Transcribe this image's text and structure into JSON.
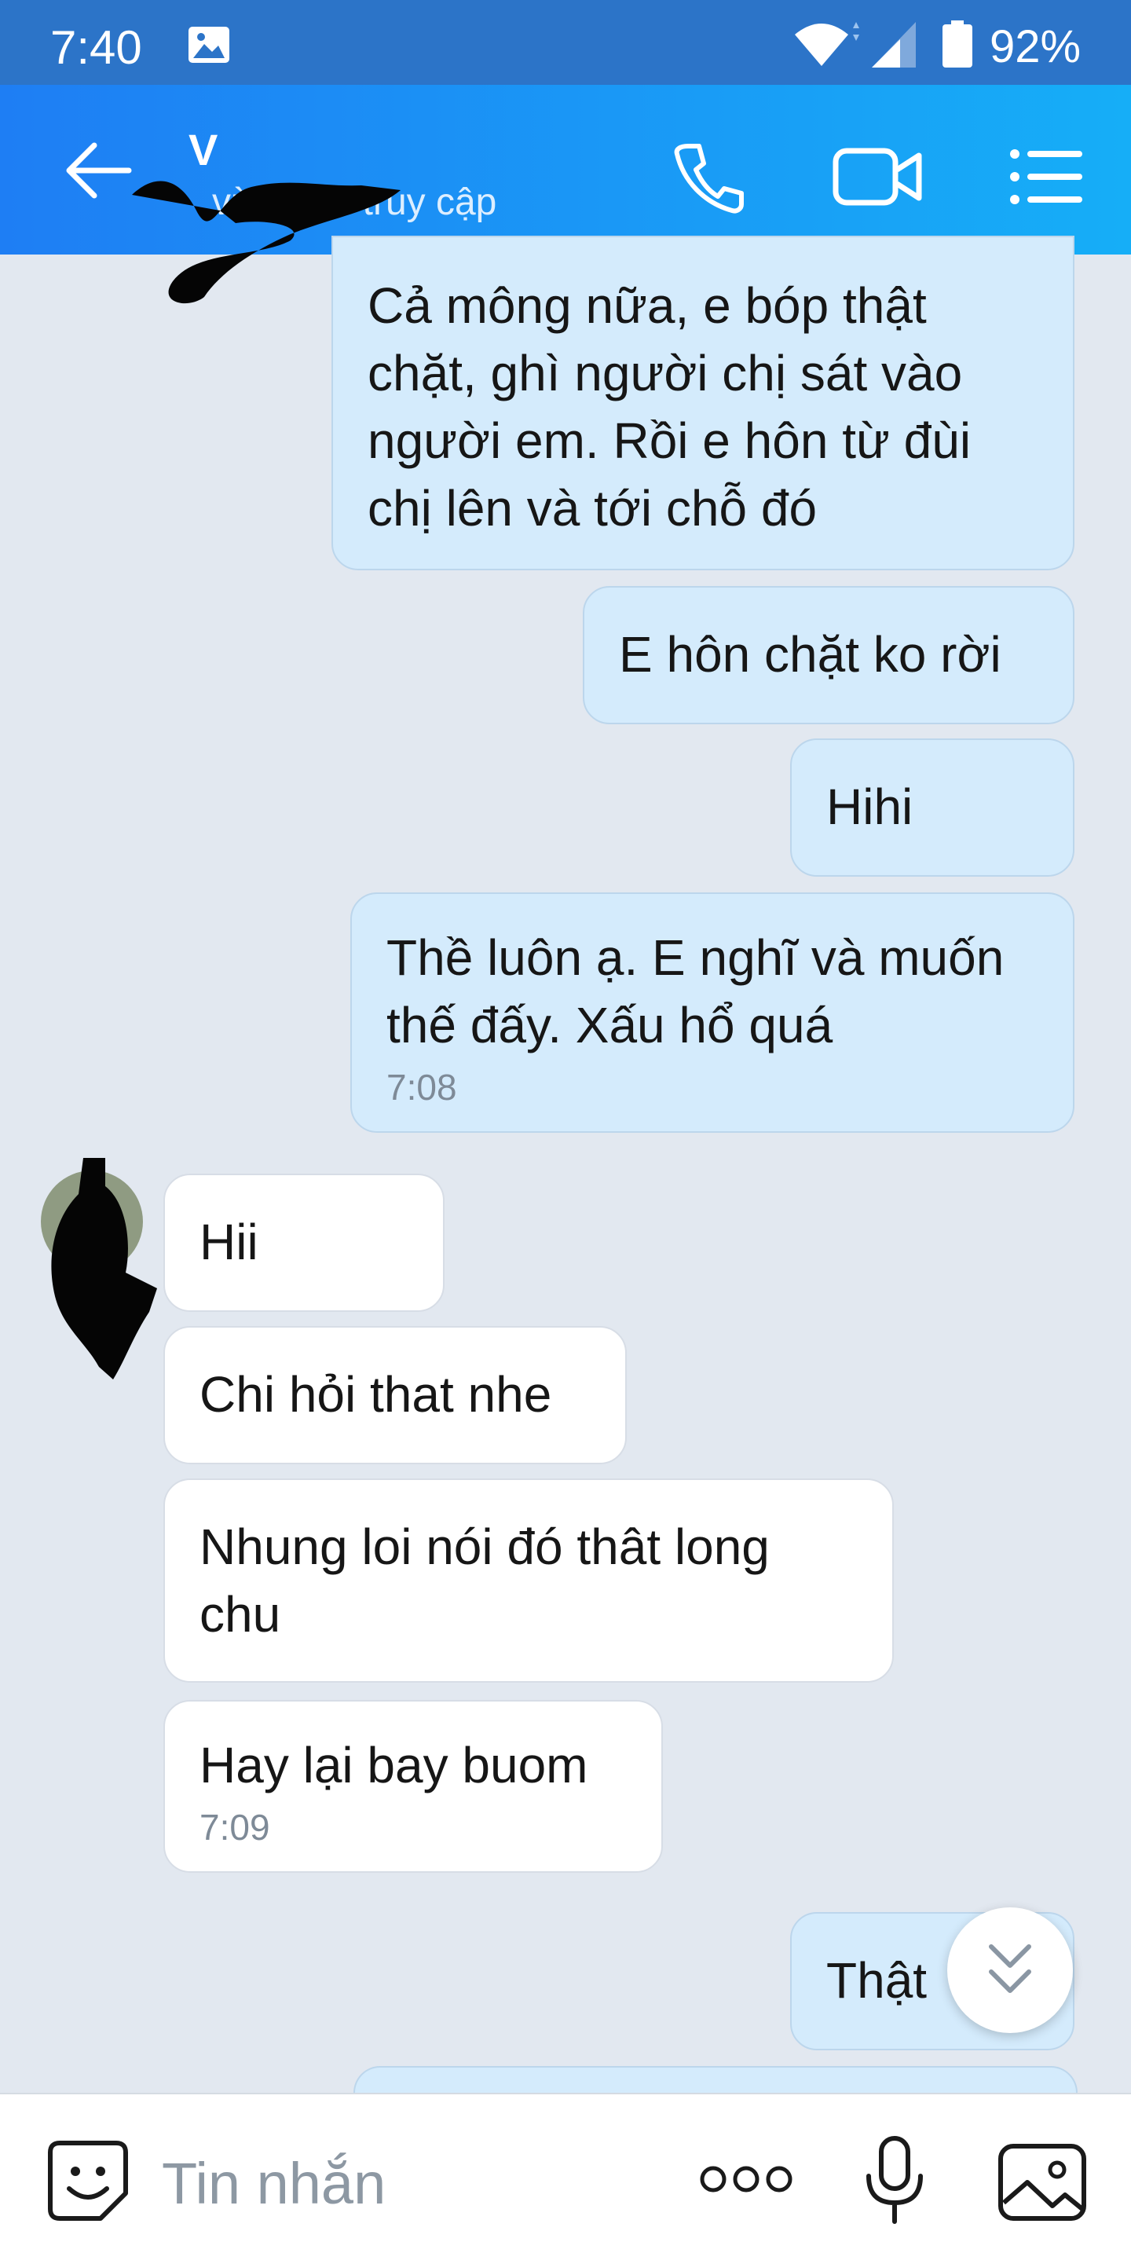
{
  "status_bar": {
    "time": "7:40",
    "battery": "92%",
    "icons": [
      "image-icon",
      "wifi-icon",
      "signal-icon",
      "battery-icon"
    ]
  },
  "header": {
    "contact_name": "V",
    "contact_status": "vừa mới truy cập",
    "icons": [
      "back-arrow-icon",
      "phone-icon",
      "video-call-icon",
      "list-menu-icon"
    ]
  },
  "messages": [
    {
      "side": "outgoing",
      "text": "Cả mông nữa, e bóp thật chặt, ghì người chị sát vào người em. Rồi e hôn từ đùi chị lên và tới chỗ đó",
      "time": ""
    },
    {
      "side": "outgoing",
      "text": "E hôn chặt ko rời",
      "time": ""
    },
    {
      "side": "outgoing",
      "text": "Hihi",
      "time": ""
    },
    {
      "side": "outgoing",
      "text": "Thề luôn ạ. E nghĩ và muốn thế đấy. Xấu hổ quá",
      "time": "7:08"
    },
    {
      "side": "incoming",
      "text": "Hii",
      "time": ""
    },
    {
      "side": "incoming",
      "text": "Chi hỏi that nhe",
      "time": ""
    },
    {
      "side": "incoming",
      "text": "Nhung loi nói đó thât long chu",
      "time": ""
    },
    {
      "side": "incoming",
      "text": "Hay lại bay buom",
      "time": "7:09"
    },
    {
      "side": "outgoing",
      "text": "Thật",
      "time": ""
    }
  ],
  "composer": {
    "placeholder": "Tin nhắn",
    "icons": [
      "sticker-icon",
      "more-options-icon",
      "microphone-icon",
      "gallery-icon"
    ]
  },
  "colors": {
    "status_bar": "#2c74c8",
    "header_start": "#1e7ef4",
    "header_end": "#16aef7",
    "chat_background": "#e2e8f0",
    "outgoing_bubble": "#d4ebfc",
    "incoming_bubble": "#ffffff"
  }
}
